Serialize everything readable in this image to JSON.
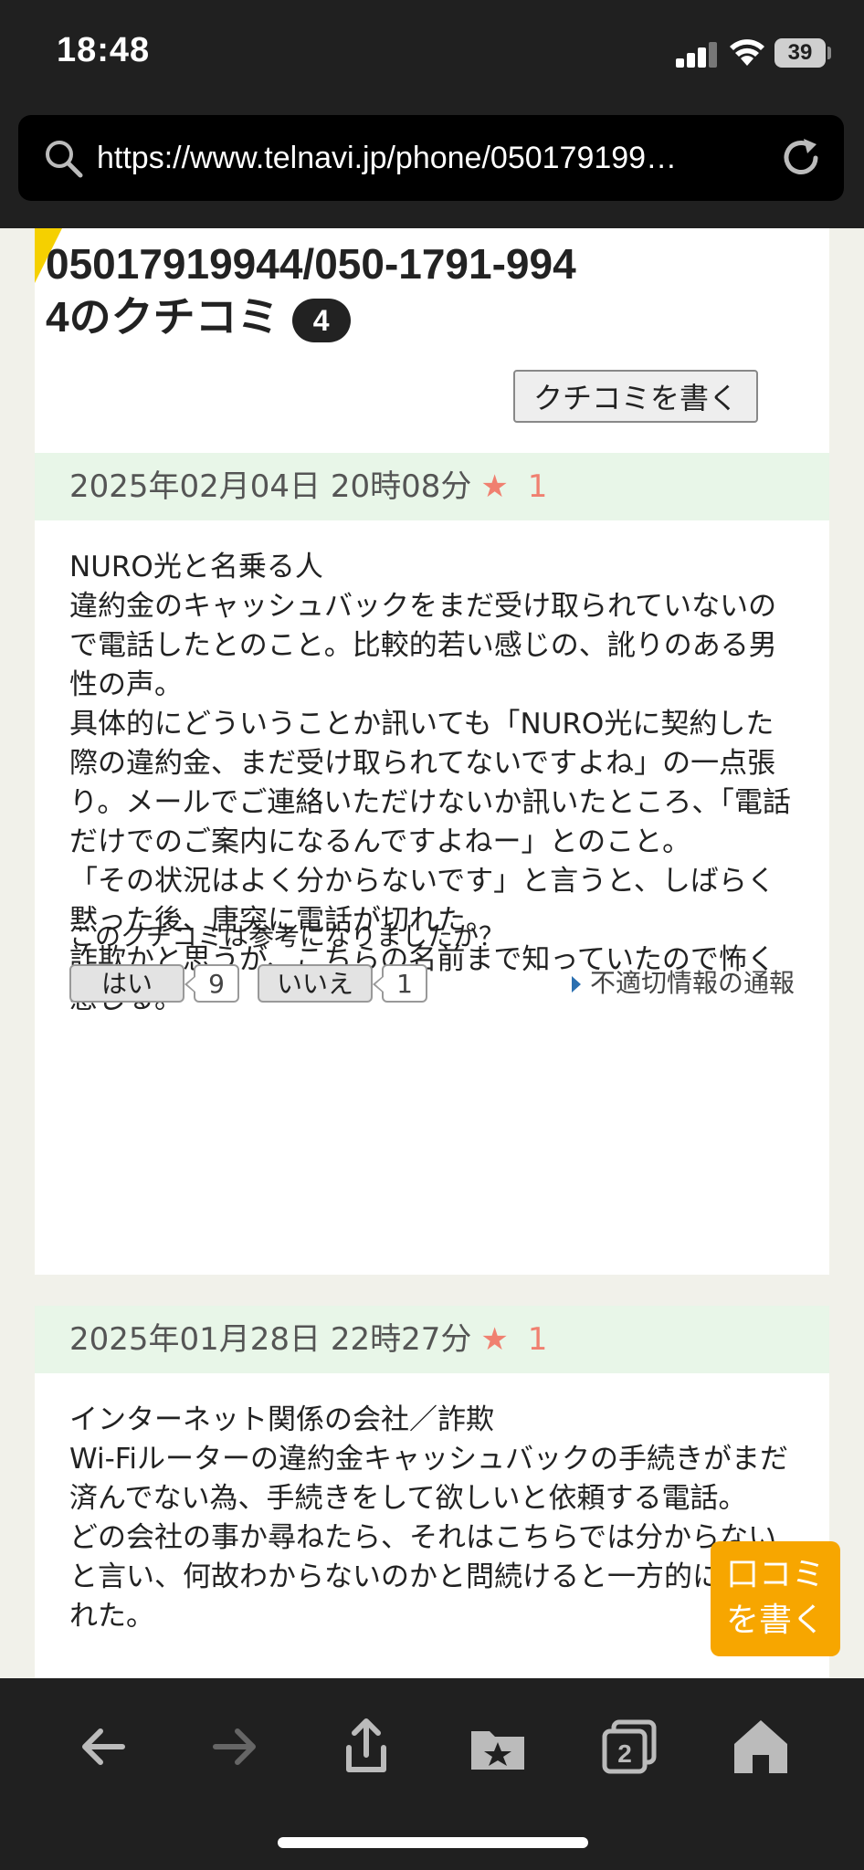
{
  "status_bar": {
    "time": "18:48",
    "battery": "39"
  },
  "url_bar": {
    "url": "https://www.telnavi.jp/phone/050179199…"
  },
  "header": {
    "title_line1": "05017919944/050-1791-994",
    "title_line2": "4のクチコミ",
    "review_count": "4",
    "write_button": "クチコミを書く"
  },
  "reviews": [
    {
      "date": "2025年02月04日 20時08分",
      "star": "★",
      "rating": "1",
      "body": "NURO光と名乗る人\n違約金のキャッシュバックをまだ受け取られていないので電話したとのこと。比較的若い感じの、訛りのある男性の声。\n具体的にどういうことか訊いても「NURO光に契約した際の違約金、まだ受け取られてないですよね」の一点張り。メールでご連絡いただけないか訊いたところ、「電話だけでのご案内になるんですよねー」とのこと。\n「その状況はよく分からないです」と言うと、しばらく黙った後、唐突に電話が切れた。\n詐欺かと思うが、こちらの名前まで知っていたので怖く感じる。",
      "helpful_question": "このクチコミは参考になりましたか？",
      "yes_label": "はい",
      "yes_count": "9",
      "no_label": "いいえ",
      "no_count": "1",
      "report_label": "不適切情報の通報"
    },
    {
      "date": "2025年01月28日 22時27分",
      "star": "★",
      "rating": "1",
      "body": "インターネット関係の会社／詐欺\nWi-Fiルーターの違約金キャッシュバックの手続きがまだ済んでない為、手続きをして欲しいと依頼する電話。\nどの会社の事か尋ねたら、それはこちらでは分からないと言い、何故わからないのかと問続けると一方的に切られた。"
    }
  ],
  "fab": {
    "line1": "口コミ",
    "line2": "を書く"
  }
}
